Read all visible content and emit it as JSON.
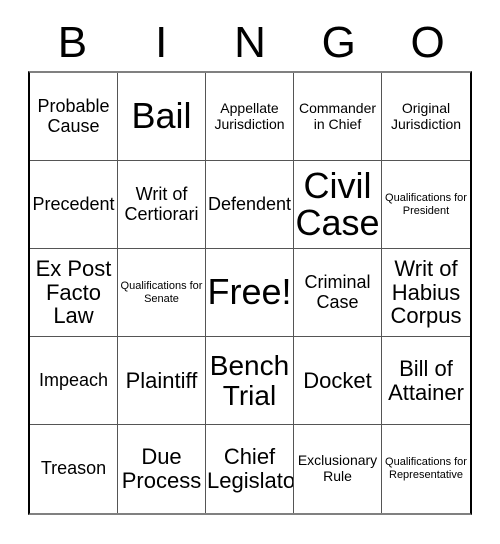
{
  "card": {
    "title_letters": [
      "B",
      "I",
      "N",
      "G",
      "O"
    ],
    "columns": 5,
    "rows": 5,
    "free_space": "Free!",
    "text_color": "#000000",
    "background_color": "#ffffff",
    "border_color": "#555555",
    "outer_border_color": "#000000"
  },
  "cells": [
    {
      "label": "Probable Cause",
      "size": "m"
    },
    {
      "label": "Bail",
      "size": "xxl"
    },
    {
      "label": "Appellate Jurisdiction",
      "size": "s"
    },
    {
      "label": "Commander in Chief",
      "size": "s"
    },
    {
      "label": "Original Jurisdiction",
      "size": "s"
    },
    {
      "label": "Precedent",
      "size": "m"
    },
    {
      "label": "Writ of Certiorari",
      "size": "m"
    },
    {
      "label": "Defendent",
      "size": "m"
    },
    {
      "label": "Civil Case",
      "size": "xxl"
    },
    {
      "label": "Qualifications for President",
      "size": "xs"
    },
    {
      "label": "Ex Post Facto Law",
      "size": "l"
    },
    {
      "label": "Qualifications for Senate",
      "size": "xs"
    },
    {
      "label": "Free!",
      "size": "xxl"
    },
    {
      "label": "Criminal Case",
      "size": "m"
    },
    {
      "label": "Writ of Habius Corpus",
      "size": "l"
    },
    {
      "label": "Impeach",
      "size": "m"
    },
    {
      "label": "Plaintiff",
      "size": "l"
    },
    {
      "label": "Bench Trial",
      "size": "xl"
    },
    {
      "label": "Docket",
      "size": "l"
    },
    {
      "label": "Bill of Attainer",
      "size": "l"
    },
    {
      "label": "Treason",
      "size": "m"
    },
    {
      "label": "Due Process",
      "size": "l"
    },
    {
      "label": "Chief Legislator",
      "size": "l"
    },
    {
      "label": "Exclusionary Rule",
      "size": "s"
    },
    {
      "label": "Qualifications for Representative",
      "size": "xs"
    }
  ]
}
